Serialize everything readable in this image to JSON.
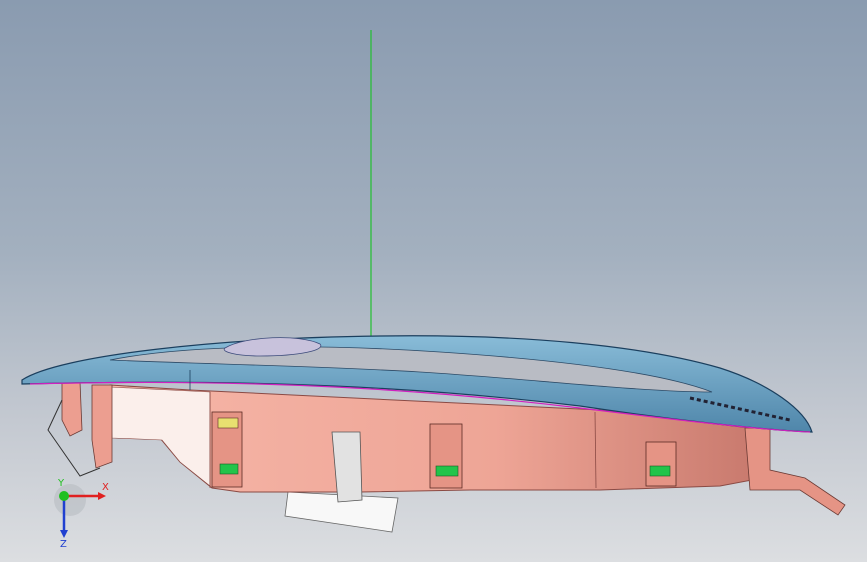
{
  "viewport": {
    "colors": {
      "background_top": "#8a9bb0",
      "background_bottom": "#dcdee1",
      "shell_body": "#f0a898",
      "shell_edge": "#8a4a44",
      "lens": "#6ea3c4",
      "lens_edge": "#1b3f5e",
      "lens_inner": "#b9bcc4",
      "clip_green": "#22c44a",
      "clip_yellow": "#e8e070",
      "z_axis_line": "#22c030",
      "magenta_edge": "#d020c0"
    },
    "triad": {
      "x_label": "X",
      "y_label": "Y",
      "z_label": "Z",
      "x_color": "#e02020",
      "y_color": "#20c020",
      "z_color": "#2040d0"
    }
  }
}
